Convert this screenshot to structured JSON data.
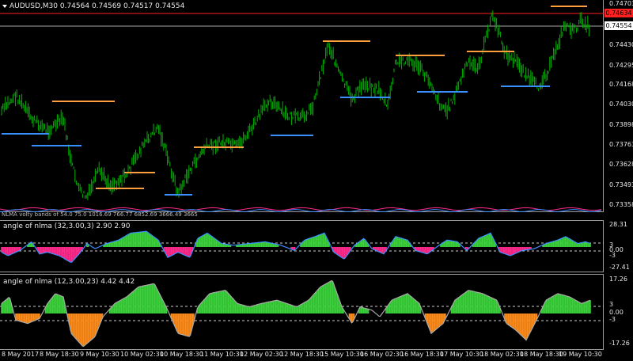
{
  "header": {
    "symbol_timeframe": "AUDUSD,M30",
    "ohlc": "0.74564 0.74569 0.74517 0.74554"
  },
  "main": {
    "price_axis": [
      "0.74703",
      "0.74430",
      "0.74295",
      "0.74168",
      "0.74030",
      "0.73898",
      "0.73763",
      "0.73628",
      "0.73493",
      "0.73358"
    ],
    "price_tags": {
      "top": "0.74634",
      "current": "0.74554"
    },
    "bands_caption": "NLMA volty bands of 54.0 75.0 1016.69 766.77 6852.69 3666.49 3665",
    "colors": {
      "bull": "#00b000",
      "band_upper": "#ff9e3d",
      "band_lower": "#3a8fff",
      "red_line": "#ff2020",
      "gray_line": "#a9a9a9"
    }
  },
  "osc1": {
    "title": "angle of nlma (32,3.00,3) 2.90 2.90",
    "axis": [
      "28.31",
      "3",
      "0.00",
      "-3",
      "-27.41"
    ],
    "colors": {
      "up": "#3cd23c",
      "down": "#ff2a8c",
      "line": "#3a8fff"
    }
  },
  "osc2": {
    "title": "angle of nlma (12,3.00,23) 4.42 4.42",
    "axis": [
      "17.26",
      "3",
      "0.00",
      "-3",
      "-17.26"
    ],
    "colors": {
      "up": "#3cd23c",
      "down": "#ff8c1a",
      "line": "#a9a9a9"
    }
  },
  "time_axis": [
    "8 May 2017",
    "8 May 18:30",
    "9 May 10:30",
    "10 May 02:30",
    "10 May 18:30",
    "11 May 10:30",
    "12 May 02:30",
    "12 May 18:30",
    "15 May 10:30",
    "16 May 02:30",
    "16 May 18:30",
    "17 May 10:30",
    "18 May 02:30",
    "18 May 18:30",
    "19 May 10:30"
  ]
}
